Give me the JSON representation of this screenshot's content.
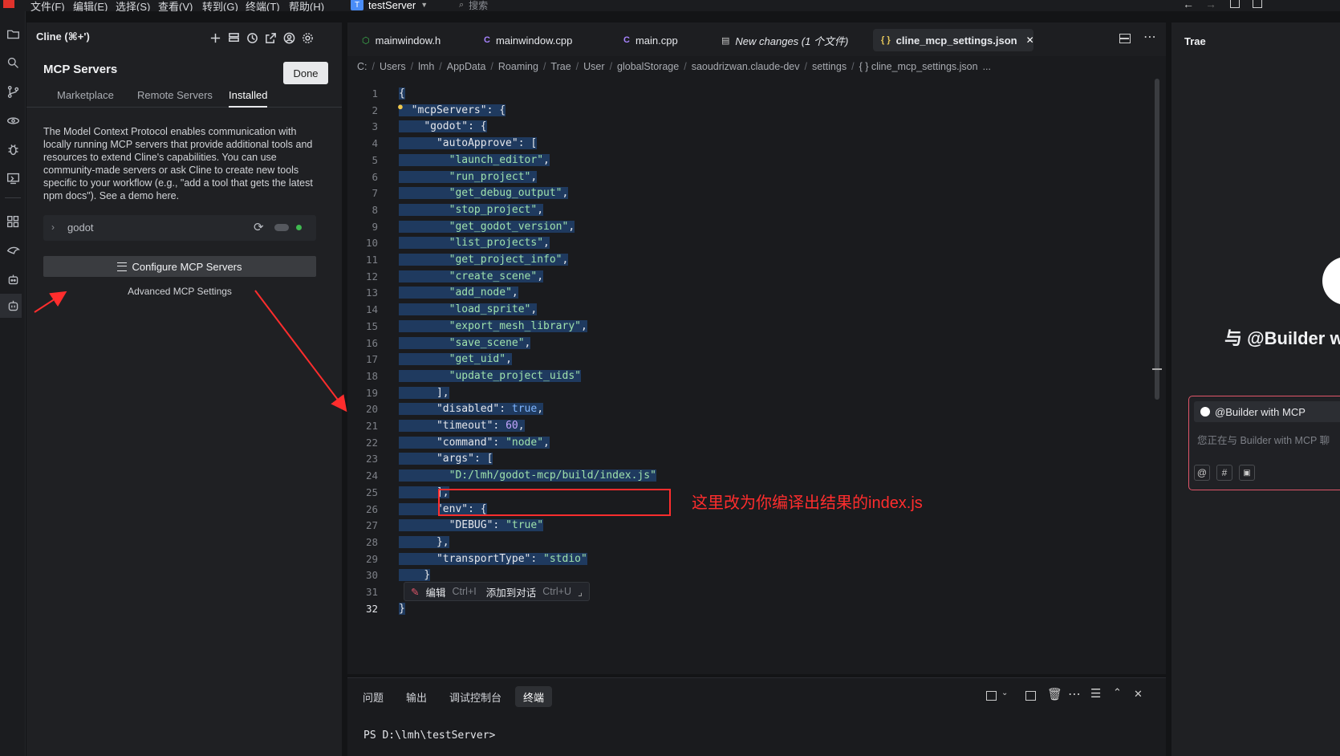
{
  "menubar": {
    "items": [
      "文件(F)",
      "编辑(E)",
      "选择(S)",
      "查看(V)",
      "转到(G)",
      "终端(T)",
      "帮助(H)"
    ],
    "project": {
      "badge": "T",
      "name": "testServer"
    },
    "search_placeholder": "搜索"
  },
  "sidebar": {
    "title": "Cline (⌘+')",
    "heading": "MCP Servers",
    "done_label": "Done",
    "tabs": [
      {
        "label": "Marketplace",
        "active": false
      },
      {
        "label": "Remote Servers",
        "active": false
      },
      {
        "label": "Installed",
        "active": true
      }
    ],
    "description": "The Model Context Protocol enables communication with locally running MCP servers that provide additional tools and resources to extend Cline's capabilities. You can use community-made servers or ask Cline to create new tools specific to your workflow (e.g., \"add a tool that gets the latest npm docs\"). See a demo here.",
    "server": {
      "name": "godot",
      "status_color": "#3fb950"
    },
    "configure_label": "Configure MCP Servers",
    "advanced_label": "Advanced MCP Settings"
  },
  "editor": {
    "tabs": [
      {
        "label": "mainwindow.h",
        "icon": "h"
      },
      {
        "label": "mainwindow.cpp",
        "icon": "c"
      },
      {
        "label": "main.cpp",
        "icon": "c"
      },
      {
        "label": "New changes (1 个文件)",
        "icon": "d"
      },
      {
        "label": "cline_mcp_settings.json",
        "icon": "{}",
        "active": true
      }
    ],
    "breadcrumb": [
      "C:",
      "Users",
      "lmh",
      "AppData",
      "Roaming",
      "Trae",
      "User",
      "globalStorage",
      "saoudrizwan.claude-dev",
      "settings",
      "{ } cline_mcp_settings.json",
      "..."
    ],
    "lines": [
      "{",
      "  \"mcpServers\": {",
      "    \"godot\": {",
      "      \"autoApprove\": [",
      "        \"launch_editor\",",
      "        \"run_project\",",
      "        \"get_debug_output\",",
      "        \"stop_project\",",
      "        \"get_godot_version\",",
      "        \"list_projects\",",
      "        \"get_project_info\",",
      "        \"create_scene\",",
      "        \"add_node\",",
      "        \"load_sprite\",",
      "        \"export_mesh_library\",",
      "        \"save_scene\",",
      "        \"get_uid\",",
      "        \"update_project_uids\"",
      "      ],",
      "      \"disabled\": true,",
      "      \"timeout\": 60,",
      "      \"command\": \"node\",",
      "      \"args\": [",
      "        \"D:/lmh/godot-mcp/build/index.js\"",
      "      ],",
      "      \"env\": {",
      "        \"DEBUG\": \"true\"",
      "      },",
      "      \"transportType\": \"stdio\"",
      "    }",
      "",
      "}"
    ],
    "inline_actions": {
      "edit": "编辑",
      "edit_shortcut": "Ctrl+I",
      "add": "添加到对话",
      "add_shortcut": "Ctrl+U"
    },
    "annotation": "这里改为你编译出结果的index.js"
  },
  "panel": {
    "tabs": [
      {
        "label": "问题",
        "active": false
      },
      {
        "label": "输出",
        "active": false
      },
      {
        "label": "调试控制台",
        "active": false
      },
      {
        "label": "终端",
        "active": true
      }
    ],
    "prompt": "PS D:\\lmh\\testServer>"
  },
  "rightpanel": {
    "title": "Trae",
    "builder_heading": "与 @Builder w",
    "chip_label": "@Builder with MCP",
    "input_placeholder": "您正在与 Builder with MCP 聊"
  },
  "colors": {
    "accent": "#4a8df8",
    "annotation": "#ff2d2d"
  }
}
